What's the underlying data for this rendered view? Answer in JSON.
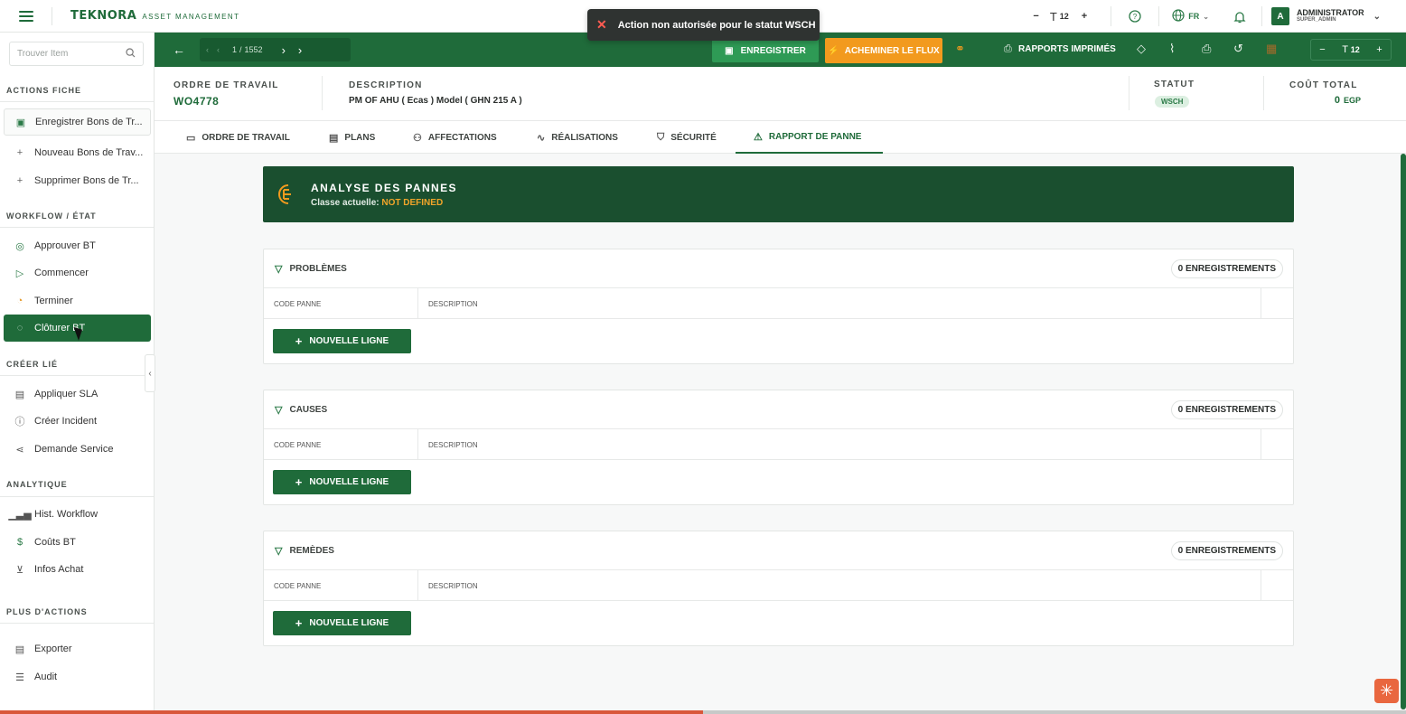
{
  "topbar": {
    "brand": "TEKNORA",
    "brand_sub": "ASSET MANAGEMENT",
    "font_minus": "−",
    "font_icon": "T",
    "font_size": "12",
    "font_plus": "+",
    "lang": "FR",
    "user_initial": "A",
    "user_name": "ADMINISTRATOR",
    "user_role": "SUPER_ADMIN"
  },
  "toast": {
    "message": "Action non autorisée pour le statut WSCH"
  },
  "sidebar": {
    "search_placeholder": "Trouver Item",
    "sections": {
      "actions": "ACTIONS FICHE",
      "workflow": "WORKFLOW / ÉTAT",
      "create": "CRÉER LIÉ",
      "analytics": "ANALYTIQUE",
      "more": "PLUS D'ACTIONS"
    },
    "items": {
      "save_wo": "Enregistrer Bons de Tr...",
      "new_wo": "Nouveau Bons de Trav...",
      "delete_wo": "Supprimer Bons de Tr...",
      "approve": "Approuver BT",
      "start": "Commencer",
      "finish": "Terminer",
      "close": "Clôturer BT",
      "apply_sla": "Appliquer SLA",
      "create_incident": "Créer Incident",
      "service_request": "Demande Service",
      "workflow_hist": "Hist. Workflow",
      "wo_costs": "Coûts BT",
      "purchase_info": "Infos Achat",
      "export": "Exporter",
      "audit": "Audit"
    }
  },
  "toolbar": {
    "pager_current": "1",
    "pager_sep": "/",
    "pager_total": "1552",
    "save_label": "ENREGISTRER",
    "flow_label": "ACHEMINER LE FLUX",
    "reports_label": "RAPPORTS IMPRIMÉS",
    "font_minus": "−",
    "font_icon": "T",
    "font_size": "12",
    "font_plus": "+"
  },
  "header": {
    "wo_label": "ORDRE DE TRAVAIL",
    "wo_value": "WO4778",
    "desc_label": "DESCRIPTION",
    "desc_value": "PM OF AHU  ( Ecas ) Model ( GHN 215 A )",
    "status_label": "STATUT",
    "status_value": "WSCH",
    "cost_label": "COÛT TOTAL",
    "cost_value": "0",
    "cost_currency": "EGP"
  },
  "tabs": {
    "work_order": "ORDRE DE TRAVAIL",
    "plans": "PLANS",
    "assignments": "AFFECTATIONS",
    "completions": "RÉALISATIONS",
    "safety": "SÉCURITÉ",
    "failure_report": "RAPPORT DE PANNE"
  },
  "analysis": {
    "title": "ANALYSE DES PANNES",
    "class_label": "Classe actuelle:",
    "class_value": "NOT DEFINED"
  },
  "panels": [
    {
      "title": "PROBLÈMES",
      "count": "0 ENREGISTREMENTS",
      "col_code": "CODE PANNE",
      "col_desc": "DESCRIPTION",
      "add_label": "NOUVELLE LIGNE"
    },
    {
      "title": "CAUSES",
      "count": "0 ENREGISTREMENTS",
      "col_code": "CODE PANNE",
      "col_desc": "DESCRIPTION",
      "add_label": "NOUVELLE LIGNE"
    },
    {
      "title": "REMÈDES",
      "count": "0 ENREGISTREMENTS",
      "col_code": "CODE PANNE",
      "col_desc": "DESCRIPTION",
      "add_label": "NOUVELLE LIGNE"
    }
  ],
  "colors": {
    "brand_green": "#1f6b3a",
    "accent_orange": "#f29a1e",
    "toast_bg": "#2f3331"
  }
}
